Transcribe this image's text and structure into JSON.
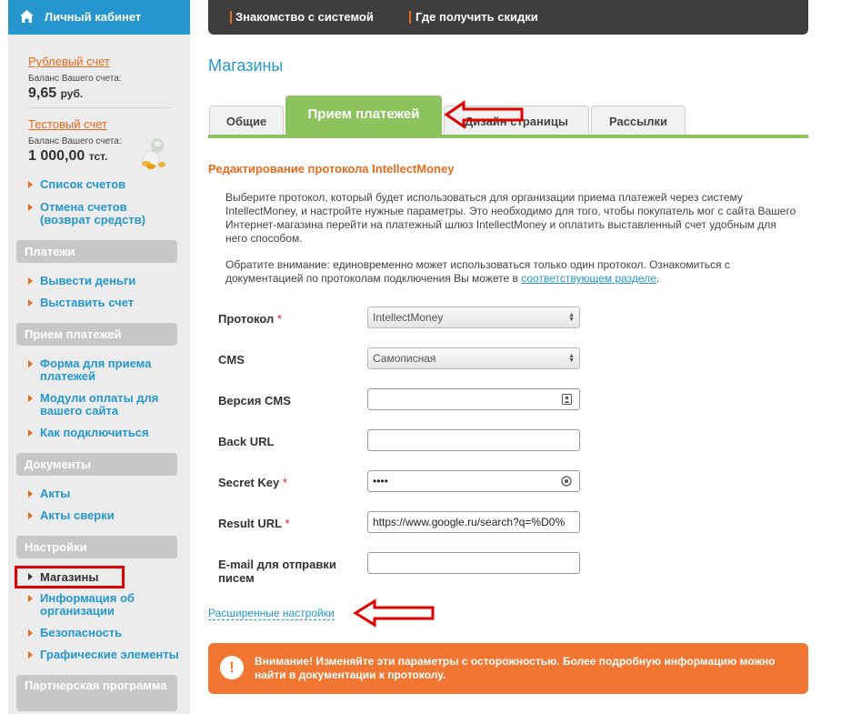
{
  "sidebar": {
    "header_title": "Личный кабинет",
    "accounts": [
      {
        "link": "Рублевый счет",
        "caption": "Баланс Вашего счета:",
        "amount": "9,65",
        "currency": "руб."
      },
      {
        "link": "Тестовый счет",
        "caption": "Баланс Вашего счета:",
        "amount": "1 000,00",
        "currency": "тст."
      }
    ],
    "account_links": [
      "Список счетов",
      "Отмена счетов (возврат средств)"
    ],
    "sections": [
      {
        "title": "Платежи",
        "items": [
          "Вывести деньги",
          "Выставить счет"
        ]
      },
      {
        "title": "Прием платежей",
        "items": [
          "Форма для приема платежей",
          "Модули оплаты для вашего сайта",
          "Как подключиться"
        ]
      },
      {
        "title": "Документы",
        "items": [
          "Акты",
          "Акты сверки"
        ]
      },
      {
        "title": "Настройки",
        "selected": "Магазины",
        "items": [
          "Информация об организации",
          "Безопасность",
          "Графические элементы"
        ]
      },
      {
        "title": "Партнерская программа"
      }
    ]
  },
  "topnav": {
    "items": [
      "Знакомство с системой",
      "Где получить скидки"
    ]
  },
  "page": {
    "title": "Магазины",
    "tabs": [
      "Общие",
      "Прием платежей",
      "Дизайн страницы",
      "Рассылки"
    ],
    "active_tab": "Прием платежей",
    "section_title": "Редактирование протокола IntellectMoney",
    "description": "Выберите протокол, который будет использоваться для организации приема платежей через систему IntellectMoney, и настройте нужные параметры. Это необходимо для того, чтобы покупатель мог с сайта Вашего Интернет-магазина перейти на платежный шлюз IntellectMoney и оплатить выставленный счет удобным для него способом.",
    "notice": "Обратите внимание: единовременно может использоваться только один протокол. Ознакомиться с документацией по протоколам подключения Вы можете в",
    "notice_link": "соответствующем разделе",
    "notice_end": "."
  },
  "form": {
    "protocol": {
      "label": "Протокол",
      "required": "*",
      "value": "IntellectMoney"
    },
    "cms": {
      "label": "CMS",
      "value": "Самописная"
    },
    "cms_version": {
      "label": "Версия CMS",
      "value": ""
    },
    "back_url": {
      "label": "Back URL",
      "value": ""
    },
    "secret_key": {
      "label": "Secret Key",
      "required": "*",
      "value": "••••"
    },
    "result_url": {
      "label": "Result URL",
      "required": "*",
      "value": "https://www.google.ru/search?q=%D0%"
    },
    "email": {
      "label": "E-mail для отправки писем",
      "value": ""
    }
  },
  "advanced_link": "Расширенные настройки",
  "warning": {
    "icon": "!",
    "text": "Внимание! Изменяйте эти параметры с осторожностью. Более подробную информацию можно найти в документации к протоколу."
  },
  "colors": {
    "accent_blue": "#2597ce",
    "accent_orange": "#e86a1d",
    "tab_green": "#8cc35c",
    "warning_bg": "#f07632",
    "annotation_red": "#e00000"
  }
}
